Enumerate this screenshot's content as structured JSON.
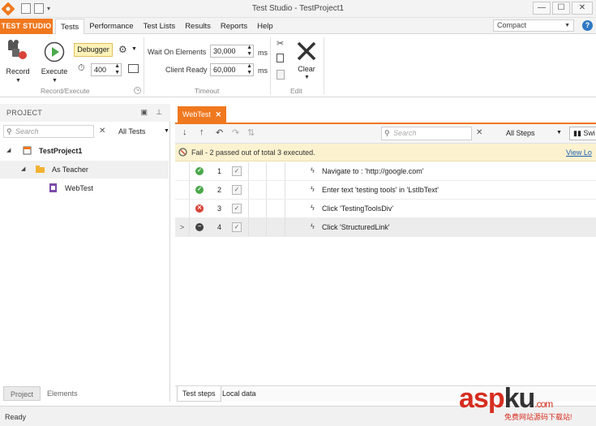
{
  "window": {
    "title": "Test Studio - TestProject1",
    "controls": [
      "—",
      "☐",
      "✕"
    ]
  },
  "menu": {
    "brand": "TEST STUDIO",
    "tabs": [
      "Tests",
      "Performance",
      "Test Lists",
      "Results",
      "Reports",
      "Help"
    ],
    "active_tab": "Tests",
    "theme_value": "Compact",
    "help_icon": "?"
  },
  "ribbon": {
    "record_label": "Record",
    "execute_label": "Execute",
    "debugger_label": "Debugger",
    "run_speed": "400",
    "group_record_execute": "Record/Execute",
    "wait_on_elements_label": "Wait On Elements",
    "wait_on_elements_value": "30,000",
    "client_ready_label": "Client Ready",
    "client_ready_value": "60,000",
    "ms_unit": "ms",
    "group_timeout": "Timeout",
    "clear_label": "Clear",
    "group_edit": "Edit"
  },
  "project_pane": {
    "header": "PROJECT",
    "search_placeholder": "Search",
    "filter_value": "All Tests",
    "tree": [
      {
        "label": "TestProject1",
        "level": 0
      },
      {
        "label": "As Teacher",
        "level": 1
      },
      {
        "label": "WebTest",
        "level": 2
      }
    ],
    "bottom_tabs": [
      "Project",
      "Elements"
    ]
  },
  "test_pane": {
    "doc_tab": "WebTest",
    "search_placeholder": "Search",
    "filter_value": "All Steps",
    "switch_label": "Swi",
    "fail_message": "Fail - 2 passed out of total 3 executed.",
    "view_log": "View Lo",
    "steps": [
      {
        "num": "1",
        "status": "pass",
        "desc": "Navigate to : 'http://google.com'"
      },
      {
        "num": "2",
        "status": "pass",
        "desc": "Enter text 'testing tools' in 'LstIbText'"
      },
      {
        "num": "3",
        "status": "fail",
        "desc": "Click 'TestingToolsDiv'"
      },
      {
        "num": "4",
        "status": "skip",
        "desc": "Click 'StructuredLink'"
      }
    ],
    "last_row_marker": ">",
    "bottom_tabs": [
      "Test steps",
      "Local data"
    ]
  },
  "status_bar": {
    "text": "Ready"
  },
  "watermark": {
    "asp": "asp",
    "ku": "ku",
    "com": ".com",
    "sub": "免费网站源码下载站!"
  },
  "colors": {
    "accent": "#f0781e",
    "pass": "#4aa84a",
    "fail": "#d9443a",
    "fail_bar": "#fcf2cf",
    "link": "#1a5fb4"
  }
}
